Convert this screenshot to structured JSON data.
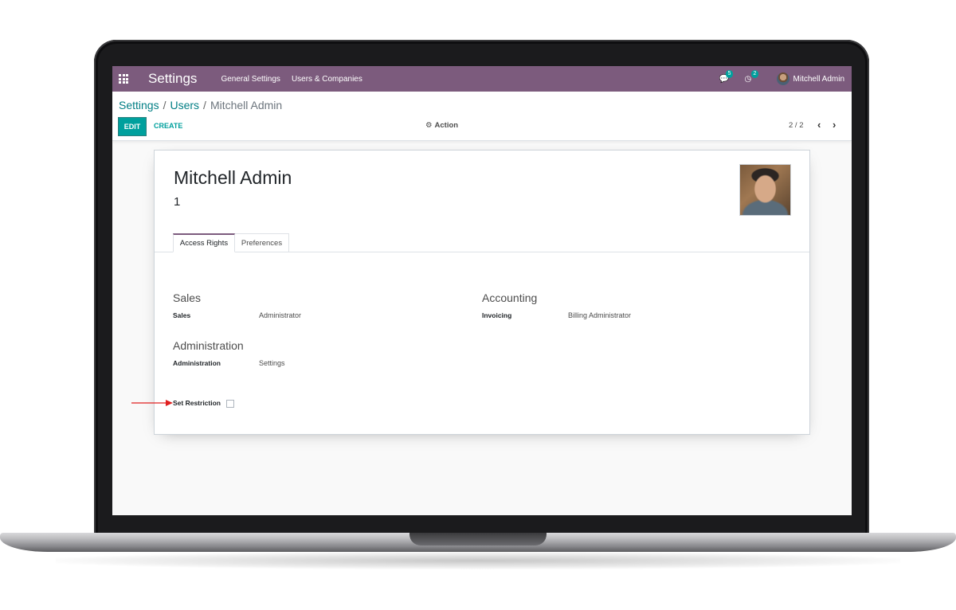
{
  "navbar": {
    "app_title": "Settings",
    "menu": [
      "General Settings",
      "Users & Companies"
    ],
    "messages_badge": "5",
    "activities_badge": "2",
    "user_name": "Mitchell Admin",
    "accent": "#7c5b7d"
  },
  "breadcrumb": {
    "root": "Settings",
    "sep1": "/",
    "users": "Users",
    "sep2": "/",
    "current": "Mitchell Admin"
  },
  "toolbar": {
    "edit_label": "EDIT",
    "create_label": "CREATE",
    "action_label": "Action",
    "pager_text": "2 / 2"
  },
  "record": {
    "name": "Mitchell Admin",
    "id_value": "1",
    "tabs": [
      "Access Rights",
      "Preferences"
    ]
  },
  "access_rights": {
    "sales": {
      "title": "Sales",
      "label": "Sales",
      "value": "Administrator"
    },
    "accounting": {
      "title": "Accounting",
      "label": "Invoicing",
      "value": "Billing Administrator"
    },
    "administration": {
      "title": "Administration",
      "label": "Administration",
      "value": "Settings"
    },
    "set_restriction_label": "Set Restriction",
    "set_restriction_checked": false
  },
  "colors": {
    "teal": "#00a09d",
    "link": "#017e84",
    "annotation_arrow": "#e02020"
  }
}
